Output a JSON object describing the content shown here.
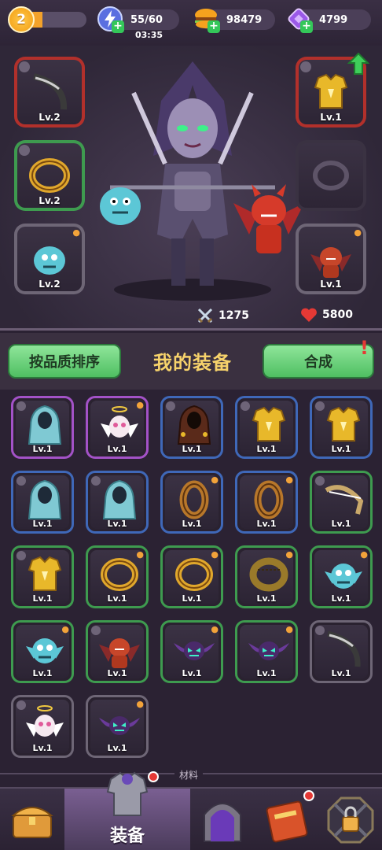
{
  "top_bar": {
    "player_level": "2",
    "xp_progress": 0.3,
    "energy": "55/60",
    "energy_timer": "03:35",
    "coins": "98479",
    "gems": "4799"
  },
  "hero": {
    "slots_left": [
      {
        "item": "bow",
        "level": "Lv.2",
        "quality": "red"
      },
      {
        "item": "ring",
        "level": "Lv.2",
        "quality": "green"
      },
      {
        "item": "pet-monster",
        "level": "Lv.2",
        "quality": "grey"
      }
    ],
    "slots_right": [
      {
        "item": "armor",
        "level": "Lv.1",
        "quality": "red"
      },
      {
        "item": "ring-empty",
        "level": "",
        "quality": "empty"
      },
      {
        "item": "pet-demon",
        "level": "Lv.1",
        "quality": "grey"
      }
    ],
    "attack": "1275",
    "hp": "5800"
  },
  "equipment": {
    "sort_button": "按品质排序",
    "title": "我的装备",
    "merge_button": "合成",
    "items": [
      {
        "item": "cloak",
        "level": "Lv.1",
        "quality": "purple",
        "marker": "dot"
      },
      {
        "item": "angel",
        "level": "Lv.1",
        "quality": "purple",
        "marker": "paw"
      },
      {
        "item": "cloak-dark",
        "level": "Lv.1",
        "quality": "blue",
        "marker": "dot"
      },
      {
        "item": "armor",
        "level": "Lv.1",
        "quality": "blue",
        "marker": "dot"
      },
      {
        "item": "armor",
        "level": "Lv.1",
        "quality": "blue",
        "marker": "dot"
      },
      {
        "item": "cloak",
        "level": "Lv.1",
        "quality": "blue",
        "marker": "dot"
      },
      {
        "item": "cloak",
        "level": "Lv.1",
        "quality": "blue",
        "marker": "dot"
      },
      {
        "item": "ring-bronze",
        "level": "Lv.1",
        "quality": "blue",
        "marker": "paw"
      },
      {
        "item": "ring-bronze",
        "level": "Lv.1",
        "quality": "blue",
        "marker": "paw"
      },
      {
        "item": "bow-gold",
        "level": "Lv.1",
        "quality": "green",
        "marker": "dot"
      },
      {
        "item": "armor",
        "level": "Lv.1",
        "quality": "green",
        "marker": "dot"
      },
      {
        "item": "ring",
        "level": "Lv.1",
        "quality": "green",
        "marker": "paw"
      },
      {
        "item": "ring",
        "level": "Lv.1",
        "quality": "green",
        "marker": "paw"
      },
      {
        "item": "ring-engraved",
        "level": "Lv.1",
        "quality": "green",
        "marker": "paw"
      },
      {
        "item": "pet-monster",
        "level": "Lv.1",
        "quality": "green",
        "marker": "paw"
      },
      {
        "item": "pet-monster",
        "level": "Lv.1",
        "quality": "green",
        "marker": "paw"
      },
      {
        "item": "pet-demon",
        "level": "Lv.1",
        "quality": "green",
        "marker": "dot"
      },
      {
        "item": "pet-bat",
        "level": "Lv.1",
        "quality": "green",
        "marker": "paw"
      },
      {
        "item": "pet-bat",
        "level": "Lv.1",
        "quality": "green",
        "marker": "paw"
      },
      {
        "item": "bow",
        "level": "Lv.1",
        "quality": "grey",
        "marker": "dot"
      },
      {
        "item": "angel",
        "level": "Lv.1",
        "quality": "grey",
        "marker": "dot"
      },
      {
        "item": "pet-bat",
        "level": "Lv.1",
        "quality": "grey",
        "marker": "paw"
      }
    ]
  },
  "materials_label": "材料",
  "bottom_nav": {
    "active_label": "装备"
  },
  "colors": {
    "purple": "#a352c7",
    "blue": "#3f68b8",
    "green": "#3e9b4f",
    "grey": "#6e6676",
    "red": "#c0392b",
    "gold": "#f7d36b"
  }
}
